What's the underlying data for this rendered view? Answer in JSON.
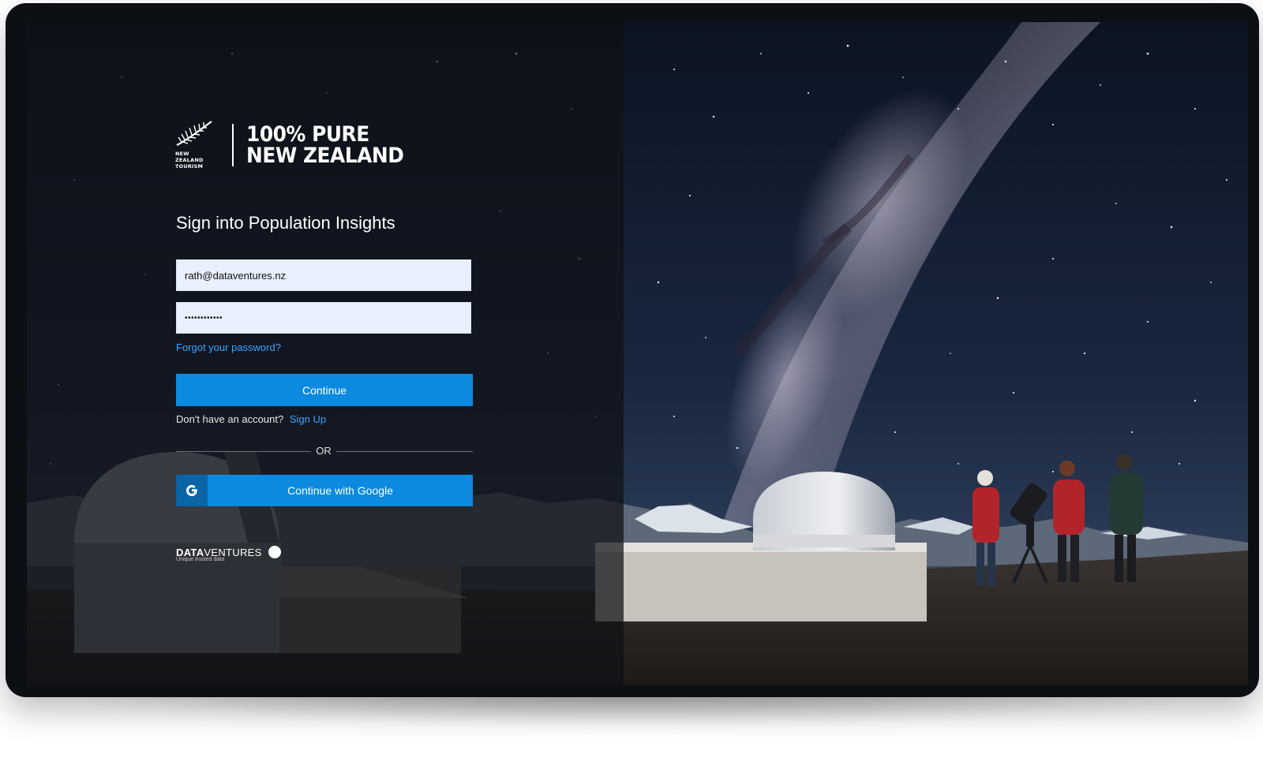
{
  "brand": {
    "fern_caption_line1": "NEW ZEALAND",
    "fern_caption_line2": "TOURISM",
    "title_line1": "100% PURE",
    "title_line2": "NEW ZEALAND"
  },
  "login": {
    "title": "Sign into Population Insights",
    "email_value": "rath@dataventures.nz",
    "password_value": "••••••••••••",
    "forgot_link": "Forgot your password?",
    "continue_label": "Continue",
    "no_account_text": "Don't have an account?",
    "signup_link": "Sign Up",
    "or_text": "OR",
    "google_label": "Continue with Google"
  },
  "footer_logo": {
    "name_bold": "DATA",
    "name_light": "VENTURES",
    "tagline": "Unique trusted data"
  },
  "icons": {
    "fern": "fern-icon",
    "google": "google-g-icon",
    "dv_dot": "circle-icon"
  },
  "colors": {
    "primary_button": "#0b8ae0",
    "google_tile": "#0a64a5",
    "link": "#3aa5ff",
    "input_bg": "#e8f0fe"
  }
}
